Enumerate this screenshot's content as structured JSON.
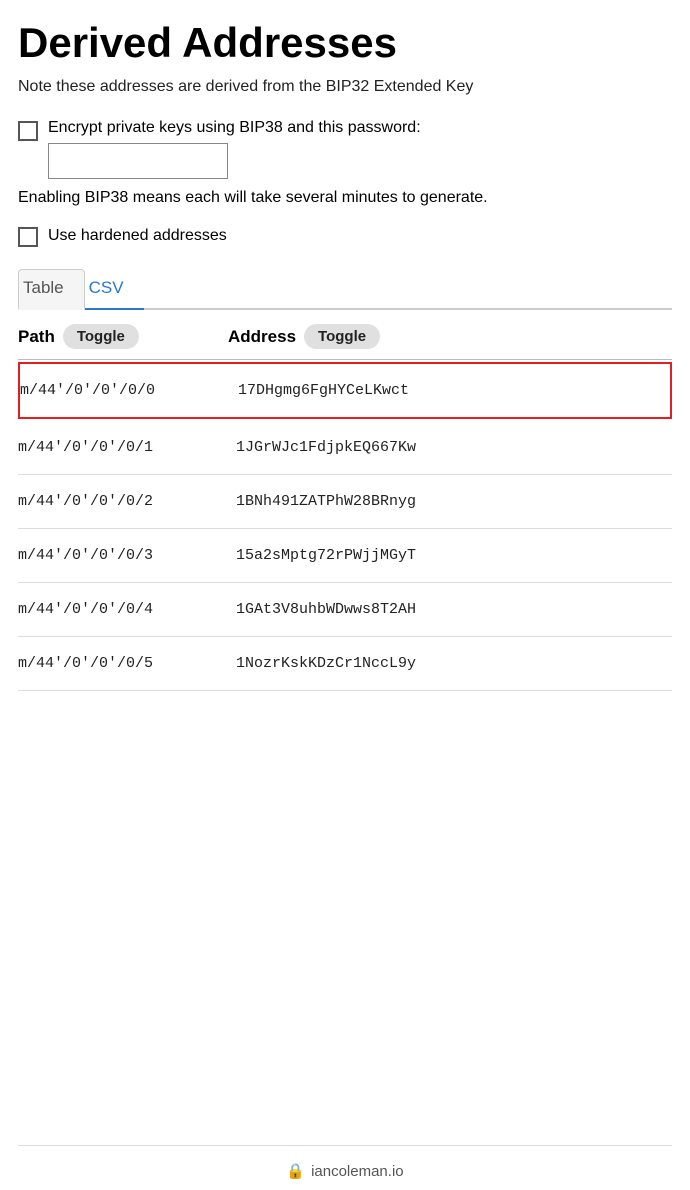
{
  "page": {
    "title": "Derived Addresses",
    "subtitle": "Note these addresses are derived from the BIP32 Extended Key",
    "bip38_checkbox_label": "Encrypt private keys using BIP38 and this password:",
    "bip38_description": "Enabling BIP38 means each will take several minutes to generate.",
    "hardened_label": "Use hardened addresses",
    "password_placeholder": "",
    "tabs": [
      {
        "label": "Table",
        "active": false
      },
      {
        "label": "CSV",
        "active": true
      }
    ],
    "table": {
      "columns": [
        {
          "label": "Path",
          "toggle_label": "Toggle"
        },
        {
          "label": "Address",
          "toggle_label": "Toggle"
        }
      ],
      "rows": [
        {
          "path": "m/44'/0'/0'/0/0",
          "address": "17DHgmg6FgHYCeLKwct",
          "highlighted": true
        },
        {
          "path": "m/44'/0'/0'/0/1",
          "address": "1JGrWJc1FdjpkEQ667Kw",
          "highlighted": false
        },
        {
          "path": "m/44'/0'/0'/0/2",
          "address": "1BNh491ZATPhW28BRnyg",
          "highlighted": false
        },
        {
          "path": "m/44'/0'/0'/0/3",
          "address": "15a2sMptg72rPWjjMGyT",
          "highlighted": false
        },
        {
          "path": "m/44'/0'/0'/0/4",
          "address": "1GAt3V8uhbWDwws8T2AH",
          "highlighted": false
        },
        {
          "path": "m/44'/0'/0'/0/5",
          "address": "1NozrKskKDzCr1NccL9y",
          "highlighted": false
        }
      ]
    },
    "footer": {
      "domain": "iancoleman.io",
      "lock_icon": "🔒"
    }
  }
}
